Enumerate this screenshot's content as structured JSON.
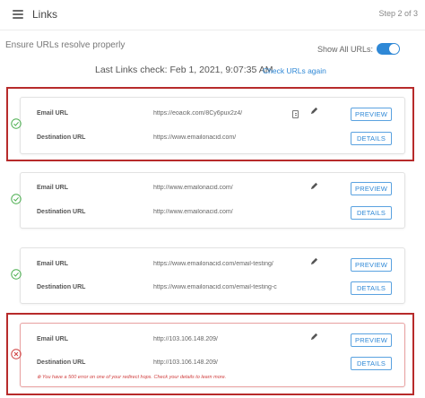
{
  "header": {
    "title": "Links",
    "step": "Step 2 of 3"
  },
  "subtitle": "Ensure URLs resolve properly",
  "show_all": {
    "label": "Show All URLs:",
    "enabled": true
  },
  "last_check": {
    "text": "Last Links check: Feb 1, 2021, 9:07:35 AM",
    "action": "Check URLs again"
  },
  "labels": {
    "email_url": "Email URL",
    "destination_url": "Destination URL",
    "preview": "PREVIEW",
    "details": "DETAILS"
  },
  "links": [
    {
      "status": "ok",
      "email_url": "https://eoacik.com/8Cy6pux2z4/",
      "destination_url": "https://www.emailonacid.com/"
    },
    {
      "status": "ok",
      "email_url": "http://www.emailonacid.com/",
      "destination_url": "http://www.emailonacid.com/"
    },
    {
      "status": "ok",
      "email_url": "https://www.emailonacid.com/email-testing/",
      "destination_url": "https://www.emailonacid.com/email-testing-c"
    },
    {
      "status": "error",
      "email_url": "http://103.106.148.209/",
      "destination_url": "http://103.106.148.209/",
      "error": "You have a 500 error on one of your redirect hops. Check your details to learn more."
    }
  ],
  "colors": {
    "accent": "#2f88d6",
    "ok": "#4caf50",
    "error": "#d04040",
    "highlight": "#b72b2b"
  }
}
